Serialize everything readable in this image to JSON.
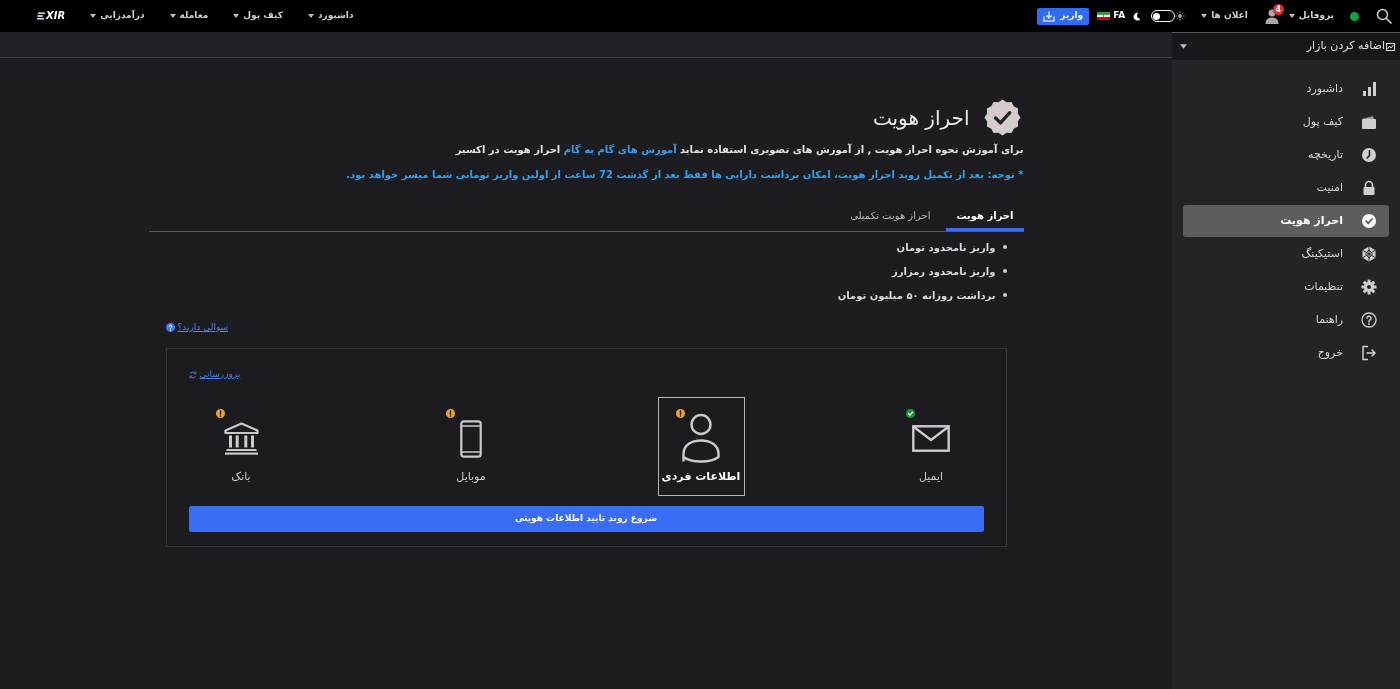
{
  "top_bar": {
    "logo": "XIR",
    "nav": [
      {
        "label": "داشبورد"
      },
      {
        "label": "کیف پول"
      },
      {
        "label": "معامله"
      },
      {
        "label": "درآمدزایی"
      }
    ],
    "online": true,
    "profile": {
      "label": "پروفایل",
      "badge": "4"
    },
    "notifications": {
      "label": "اعلان ها"
    },
    "light_mode": false,
    "language": "FA",
    "deposit_button": "واریز"
  },
  "sidebar": {
    "add_market": "اضافه کردن بازار",
    "items": [
      {
        "label": "داشبورد",
        "kind": "dashboard",
        "selected": false
      },
      {
        "label": "کیف پول",
        "kind": "wallet",
        "selected": false
      },
      {
        "label": "تاریخچه",
        "kind": "history",
        "selected": false
      },
      {
        "label": "امنیت",
        "kind": "security",
        "selected": false
      },
      {
        "label": "احراز هویت",
        "kind": "verification",
        "selected": true
      },
      {
        "label": "استیکینگ",
        "kind": "staking",
        "selected": false
      },
      {
        "label": "تنظیمات",
        "kind": "settings",
        "selected": false
      },
      {
        "label": "راهنما",
        "kind": "help",
        "selected": false
      },
      {
        "label": "خروج",
        "kind": "logout",
        "selected": false
      }
    ]
  },
  "page": {
    "title": "احراز هویت",
    "intro": {
      "text": "برای آموزش نحوه احراز هویت , از آموزش های تصویری استفاده نماید",
      "link": "آموزش های گام به گام",
      "text_after": "احراز هویت در اکسیر"
    },
    "notice": "* توجه: بعد از تکمیل روند احراز هویت، امکان برداشت دارایی ها فقط بعد از گذشت 72 ساعت از اولین واریز تومانی شما میسر خواهد بود.",
    "tabs": [
      {
        "label": "احراز هویت",
        "selected": true
      },
      {
        "label": "احراز هویت تکمیلی",
        "selected": false
      }
    ],
    "benefits": [
      "واریز نامحدود تومان",
      "واریز نامحدود رمزارز",
      "برداشت روزانه ۵۰ میلیون تومان"
    ],
    "help_link": "سوالی دارید؟",
    "card": {
      "refresh_link": "بروزرسانی",
      "steps": [
        {
          "label": "ایمیل",
          "kind": "email",
          "verified": true,
          "selected": false
        },
        {
          "label": "اطلاعات فردی",
          "kind": "personal",
          "verified": false,
          "selected": true
        },
        {
          "label": "موبایل",
          "kind": "mobile",
          "verified": false,
          "selected": false
        },
        {
          "label": "بانک",
          "kind": "bank",
          "verified": false,
          "selected": false
        }
      ],
      "start_button": "شروع روند تایید اطلاعات هویتی"
    }
  }
}
